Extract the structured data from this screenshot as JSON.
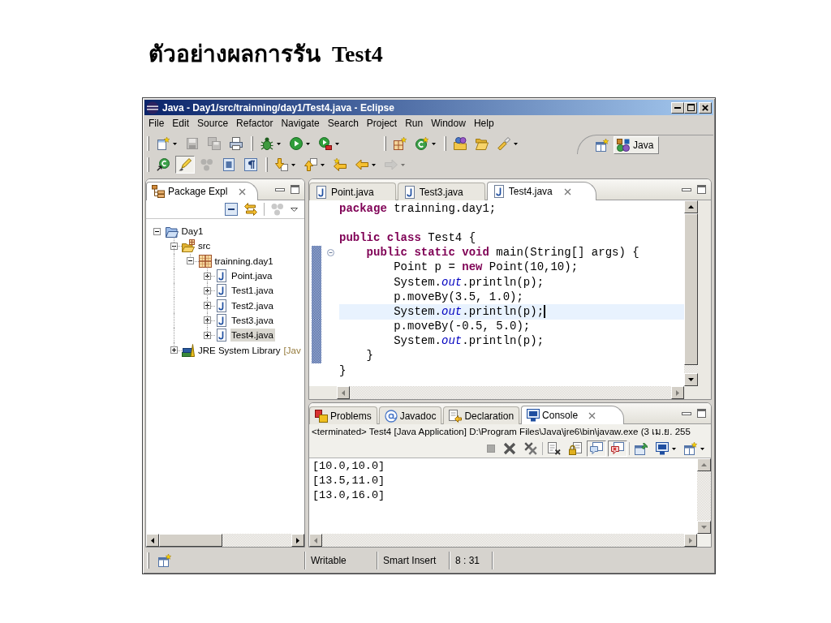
{
  "slide_title": "ตัวอย่างผลการรัน  Test4",
  "window": {
    "title": "Java - Day1/src/trainning/day1/Test4.java - Eclipse"
  },
  "menu": [
    "File",
    "Edit",
    "Source",
    "Refactor",
    "Navigate",
    "Search",
    "Project",
    "Run",
    "Window",
    "Help"
  ],
  "toolbar": {
    "rows": [
      [
        [
          {
            "disabled": false,
            "pressed": false,
            "dropdown": true
          },
          {
            "disabled": true,
            "pressed": false,
            "dropdown": false
          },
          {
            "disabled": true,
            "pressed": false,
            "dropdown": false
          },
          {
            "disabled": false,
            "pressed": false,
            "dropdown": false
          }
        ],
        [
          {
            "disabled": false,
            "pressed": false,
            "dropdown": true
          },
          {
            "disabled": false,
            "pressed": false,
            "dropdown": true
          },
          {
            "disabled": false,
            "pressed": false,
            "dropdown": true
          }
        ],
        [
          {
            "disabled": false,
            "pressed": false,
            "dropdown": false
          },
          {
            "disabled": false,
            "pressed": false,
            "dropdown": true
          }
        ],
        [
          {
            "disabled": false,
            "pressed": false,
            "dropdown": false
          },
          {
            "disabled": false,
            "pressed": false,
            "dropdown": false
          },
          {
            "disabled": false,
            "pressed": false,
            "dropdown": true
          }
        ]
      ],
      [
        [
          {
            "disabled": false,
            "pressed": false,
            "dropdown": false
          },
          {
            "disabled": false,
            "pressed": true,
            "dropdown": false
          },
          {
            "disabled": true,
            "pressed": false,
            "dropdown": false
          },
          {
            "disabled": false,
            "pressed": false,
            "dropdown": false
          },
          {
            "disabled": false,
            "pressed": false,
            "dropdown": false
          }
        ],
        [
          {
            "disabled": false,
            "pressed": false,
            "dropdown": true
          },
          {
            "disabled": false,
            "pressed": false,
            "dropdown": true
          },
          {
            "disabled": false,
            "pressed": false,
            "dropdown": false
          },
          {
            "disabled": false,
            "pressed": false,
            "dropdown": true
          },
          {
            "disabled": true,
            "pressed": false,
            "dropdown": true
          }
        ]
      ]
    ]
  },
  "perspective": {
    "label": "Java",
    "selected": true
  },
  "package_explorer": {
    "tab": "Package Expl",
    "toolbar": [
      [
        {
          "disabled": false
        },
        {
          "disabled": false
        }
      ],
      [
        {
          "disabled": true
        }
      ]
    ],
    "tree": [
      {
        "label": "Day1",
        "kind": "project",
        "expanded": true,
        "selected": false,
        "children": [
          {
            "label": "src",
            "kind": "source_folder",
            "expanded": true,
            "selected": false,
            "children": [
              {
                "label": "trainning.day1",
                "kind": "package",
                "expanded": true,
                "selected": false,
                "children": [
                  {
                    "label": "Point.java",
                    "kind": "file",
                    "expanded": false,
                    "selected": false
                  },
                  {
                    "label": "Test1.java",
                    "kind": "file",
                    "expanded": false,
                    "selected": false
                  },
                  {
                    "label": "Test2.java",
                    "kind": "file",
                    "expanded": false,
                    "selected": false
                  },
                  {
                    "label": "Test3.java",
                    "kind": "file",
                    "expanded": false,
                    "selected": false
                  },
                  {
                    "label": "Test4.java",
                    "kind": "file",
                    "expanded": false,
                    "selected": true
                  }
                ]
              }
            ]
          },
          {
            "label": "JRE System Library",
            "decoration": "[Jav",
            "kind": "library",
            "expanded": false,
            "selected": false
          }
        ]
      }
    ]
  },
  "editor": {
    "tabs": [
      {
        "label": "Point.java",
        "selected": false
      },
      {
        "label": "Test3.java",
        "selected": false
      },
      {
        "label": "Test4.java",
        "selected": true
      }
    ],
    "lines": [
      {
        "kind": "code",
        "text": "**package** trainning.day1;",
        "current": false,
        "in_range": false,
        "foldable": false
      },
      {
        "kind": "blank",
        "current": false,
        "in_range": false,
        "foldable": false
      },
      {
        "kind": "code",
        "text": "**public class** Test4 {",
        "current": false,
        "in_range": false,
        "foldable": false
      },
      {
        "kind": "code",
        "text": "    **public static void** main(String[] args) {",
        "current": false,
        "in_range": true,
        "foldable": true
      },
      {
        "kind": "code",
        "text": "        Point p = **new** Point(10,10);",
        "current": false,
        "in_range": true,
        "foldable": false
      },
      {
        "kind": "code",
        "text": "        System.*out*.println(p);",
        "current": false,
        "in_range": true,
        "foldable": false
      },
      {
        "kind": "code",
        "text": "        p.moveBy(3.5, 1.0);",
        "current": false,
        "in_range": true,
        "foldable": false
      },
      {
        "kind": "code",
        "text": "        System.*out*.println(p);",
        "current": true,
        "in_range": true,
        "foldable": false
      },
      {
        "kind": "code",
        "text": "        p.moveBy(-0.5, 5.0);",
        "current": false,
        "in_range": true,
        "foldable": false
      },
      {
        "kind": "code",
        "text": "        System.*out*.println(p);",
        "current": false,
        "in_range": true,
        "foldable": false
      },
      {
        "kind": "code",
        "text": "    }",
        "current": false,
        "in_range": true,
        "foldable": false
      },
      {
        "kind": "code",
        "text": "}",
        "current": false,
        "in_range": false,
        "foldable": false
      }
    ]
  },
  "console": {
    "tabs": [
      {
        "label": "Problems",
        "selected": false
      },
      {
        "label": "Javadoc",
        "selected": false
      },
      {
        "label": "Declaration",
        "selected": false
      },
      {
        "label": "Console",
        "selected": true
      }
    ],
    "header": "<terminated> Test4 [Java Application] D:\\Program Files\\Java\\jre6\\bin\\javaw.exe (3 เม.ย. 255",
    "toolbar": [
      [
        {
          "disabled": true,
          "pressed": false,
          "dropdown": false
        },
        {
          "disabled": false,
          "pressed": false,
          "dropdown": false
        },
        {
          "disabled": false,
          "pressed": false,
          "dropdown": false
        }
      ],
      [
        {
          "disabled": false,
          "pressed": false,
          "dropdown": false
        },
        {
          "disabled": false,
          "pressed": false,
          "dropdown": false
        },
        {
          "disabled": false,
          "pressed": true,
          "dropdown": false
        },
        {
          "disabled": false,
          "pressed": true,
          "dropdown": false
        }
      ],
      [
        {
          "disabled": false,
          "pressed": false,
          "dropdown": false
        },
        {
          "disabled": false,
          "pressed": false,
          "dropdown": true
        },
        {
          "disabled": false,
          "pressed": false,
          "dropdown": true
        }
      ]
    ],
    "output": [
      "[10.0,10.0]",
      "[13.5,11.0]",
      "[13.0,16.0]"
    ]
  },
  "status_bar": {
    "fields": [
      "Writable",
      "Smart Insert",
      "8 : 31"
    ]
  }
}
